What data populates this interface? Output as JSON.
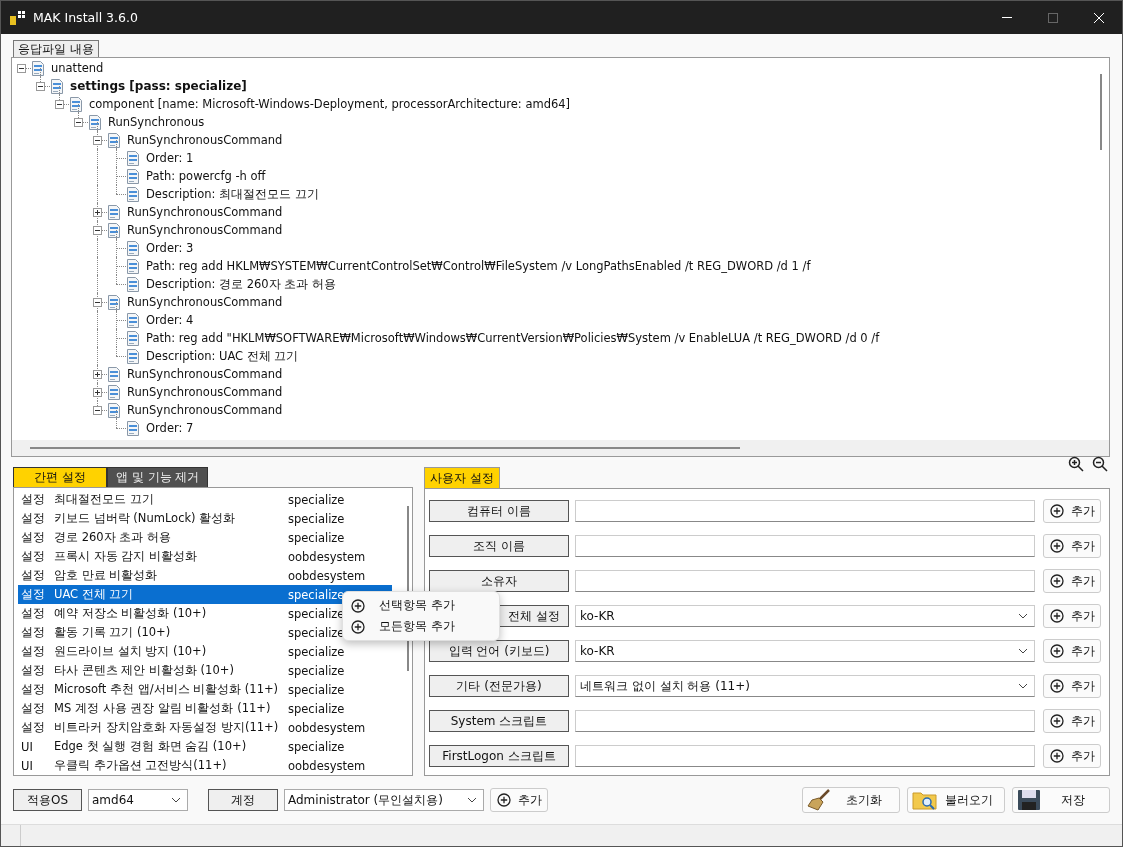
{
  "window": {
    "title": "MAK Install 3.6.0",
    "controls": [
      {
        "kind": "minimize",
        "disabled": false
      },
      {
        "kind": "maximize",
        "disabled": true
      },
      {
        "kind": "close",
        "disabled": false
      }
    ]
  },
  "answer_file": {
    "title": "응답파일 내용",
    "tree": [
      {
        "label": "unattend",
        "expanded": true,
        "bold": false,
        "children": [
          {
            "label": "settings [pass: specialize]",
            "expanded": true,
            "bold": true,
            "children": [
              {
                "label": "component [name: Microsoft-Windows-Deployment, processorArchitecture: amd64]",
                "expanded": true,
                "bold": false,
                "children": [
                  {
                    "label": "RunSynchronous",
                    "expanded": true,
                    "bold": false,
                    "children": [
                      {
                        "label": "RunSynchronousCommand",
                        "expanded": true,
                        "bold": false,
                        "children": [
                          {
                            "label": "Order: 1",
                            "bold": false
                          },
                          {
                            "label": "Path: powercfg -h off",
                            "bold": false
                          },
                          {
                            "label": "Description: 최대절전모드 끄기",
                            "bold": false
                          }
                        ]
                      },
                      {
                        "label": "RunSynchronousCommand",
                        "expanded": false,
                        "bold": false
                      },
                      {
                        "label": "RunSynchronousCommand",
                        "expanded": true,
                        "bold": false,
                        "children": [
                          {
                            "label": "Order: 3",
                            "bold": false
                          },
                          {
                            "label": "Path: reg add HKLM₩SYSTEM₩CurrentControlSet₩Control₩FileSystem /v LongPathsEnabled /t REG_DWORD /d 1 /f",
                            "bold": false
                          },
                          {
                            "label": "Description: 경로 260자 초과 허용",
                            "bold": false
                          }
                        ]
                      },
                      {
                        "label": "RunSynchronousCommand",
                        "expanded": true,
                        "bold": false,
                        "children": [
                          {
                            "label": "Order: 4",
                            "bold": false
                          },
                          {
                            "label": "Path: reg add \"HKLM₩SOFTWARE₩Microsoft₩Windows₩CurrentVersion₩Policies₩System /v EnableLUA /t REG_DWORD /d 0 /f",
                            "bold": false
                          },
                          {
                            "label": "Description: UAC 전체 끄기",
                            "bold": false
                          }
                        ]
                      },
                      {
                        "label": "RunSynchronousCommand",
                        "expanded": false,
                        "bold": false
                      },
                      {
                        "label": "RunSynchronousCommand",
                        "expanded": false,
                        "bold": false
                      },
                      {
                        "label": "RunSynchronousCommand",
                        "expanded": true,
                        "bold": false,
                        "children": [
                          {
                            "label": "Order: 7",
                            "bold": false
                          }
                        ]
                      }
                    ]
                  }
                ]
              }
            ]
          }
        ]
      }
    ]
  },
  "left_tabs": [
    {
      "label": "간편 설정",
      "selected": true
    },
    {
      "label": "앱 및 기능 제거",
      "selected": false
    }
  ],
  "presets": [
    {
      "type": "설정",
      "name": "최대절전모드 끄기",
      "pass": "specialize",
      "selected": false
    },
    {
      "type": "설정",
      "name": "키보드 넘버락 (NumLock) 활성화",
      "pass": "specialize",
      "selected": false
    },
    {
      "type": "설정",
      "name": "경로 260자 초과 허용",
      "pass": "specialize",
      "selected": false
    },
    {
      "type": "설정",
      "name": "프록시 자동 감지 비활성화",
      "pass": "oobdesystem",
      "selected": false
    },
    {
      "type": "설정",
      "name": "암호 만료 비활성화",
      "pass": "oobdesystem",
      "selected": false
    },
    {
      "type": "설정",
      "name": "UAC 전체 끄기",
      "pass": "specialize",
      "selected": true
    },
    {
      "type": "설정",
      "name": "예약 저장소 비활성화 (10+)",
      "pass": "specialize",
      "selected": false
    },
    {
      "type": "설정",
      "name": "활동 기록 끄기 (10+)",
      "pass": "specialize",
      "selected": false
    },
    {
      "type": "설정",
      "name": "원드라이브 설치 방지 (10+)",
      "pass": "specialize",
      "selected": false
    },
    {
      "type": "설정",
      "name": "타사 콘텐츠 제안 비활성화 (10+)",
      "pass": "specialize",
      "selected": false
    },
    {
      "type": "설정",
      "name": "Microsoft 추천 앱/서비스 비활성화 (11+)",
      "pass": "specialize",
      "selected": false
    },
    {
      "type": "설정",
      "name": "MS 계정 사용 권장 알림 비활성화 (11+)",
      "pass": "specialize",
      "selected": false
    },
    {
      "type": "설정",
      "name": "비트라커 장치암호화 자동설정 방지(11+)",
      "pass": "oobdesystem",
      "selected": false
    },
    {
      "type": "UI",
      "name": "Edge 첫 실행 경험 화면 숨김 (10+)",
      "pass": "specialize",
      "selected": false
    },
    {
      "type": "UI",
      "name": "우클릭 추가옵션 고전방식(11+)",
      "pass": "oobdesystem",
      "selected": false
    }
  ],
  "context_menu": [
    {
      "label": "선택항목 추가"
    },
    {
      "label": "모든항목 추가"
    }
  ],
  "user_tab": {
    "label": "사용자 설정",
    "selected": true
  },
  "user_settings": [
    {
      "label": "컴퓨터 이름",
      "kind": "text",
      "button": "추가"
    },
    {
      "label": "조직 이름",
      "kind": "text",
      "button": "추가"
    },
    {
      "label": "소유자",
      "kind": "text",
      "button": "추가"
    },
    {
      "label": "전체 설정",
      "kind": "select",
      "value": "ko-KR",
      "button": "추가"
    },
    {
      "label": "입력 언어 (키보드)",
      "kind": "select",
      "value": "ko-KR",
      "button": "추가"
    },
    {
      "label": "기타 (전문가용)",
      "kind": "select",
      "value": "네트워크 없이 설치 허용 (11+)",
      "button": "추가"
    },
    {
      "label": "System 스크립트",
      "kind": "text",
      "button": "추가"
    },
    {
      "label": "FirstLogon 스크립트",
      "kind": "text",
      "button": "추가"
    }
  ],
  "bottom": {
    "os_label": "적용OS",
    "os_value": "amd64",
    "account_label": "계정",
    "account_value": "Administrator (무인설치용)",
    "add_button": "추가",
    "actions": [
      {
        "label": "초기화",
        "kind": "reset"
      },
      {
        "label": "불러오기",
        "kind": "load"
      },
      {
        "label": "저장",
        "kind": "save"
      }
    ]
  }
}
